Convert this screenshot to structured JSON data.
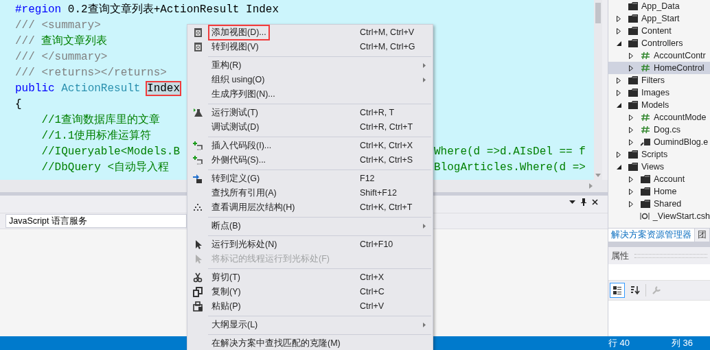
{
  "editor": {
    "lines": [
      {
        "segments": [
          {
            "text": "#region",
            "kind": "keyword"
          },
          {
            "text": " 0.2查询文章列表+ActionResult Index",
            "kind": "plain"
          }
        ]
      },
      {
        "segments": [
          {
            "text": "/// <summary>",
            "kind": "doc"
          }
        ]
      },
      {
        "segments": [
          {
            "text": "/// ",
            "kind": "doc"
          },
          {
            "text": "查询文章列表",
            "kind": "comment"
          }
        ]
      },
      {
        "segments": [
          {
            "text": "/// </summary>",
            "kind": "doc"
          }
        ]
      },
      {
        "segments": [
          {
            "text": "/// <returns></returns>",
            "kind": "doc"
          }
        ]
      },
      {
        "segments": [
          {
            "text": "public ",
            "kind": "keyword"
          },
          {
            "text": "ActionResult ",
            "kind": "type"
          },
          {
            "text": "Index",
            "kind": "plain",
            "marked": true
          }
        ]
      },
      {
        "segments": [
          {
            "text": "{",
            "kind": "plain"
          }
        ]
      },
      {
        "segments": [
          {
            "text": "    //1查询数据库里的文章",
            "kind": "comment"
          }
        ]
      },
      {
        "segments": [
          {
            "text": "    //1.1使用标准运算符",
            "kind": "comment"
          }
        ]
      },
      {
        "segments": [
          {
            "text": "    //IQueryable<Models.B",
            "kind": "comment"
          }
        ],
        "tail": {
          "text": "Where(d =>d.AIsDel == f",
          "kind": "comment"
        }
      },
      {
        "segments": [
          {
            "text": "    //DbQuery <自动导入程",
            "kind": "comment"
          }
        ],
        "tail": {
          "text": "BlogArticles.Where(d =>",
          "kind": "comment"
        }
      }
    ]
  },
  "context_menu": {
    "items": [
      {
        "kind": "item",
        "label": "添加视图(D)...",
        "shortcut": "Ctrl+M, Ctrl+V",
        "marked": true,
        "disabled": false,
        "submenu": false
      },
      {
        "kind": "item",
        "label": "转到视图(V)",
        "shortcut": "Ctrl+M, Ctrl+G",
        "marked": false,
        "disabled": false,
        "submenu": false
      },
      {
        "kind": "separator"
      },
      {
        "kind": "item",
        "label": "重构(R)",
        "marked": false,
        "disabled": false,
        "submenu": true
      },
      {
        "kind": "item",
        "label": "组织 using(O)",
        "marked": false,
        "disabled": false,
        "submenu": true
      },
      {
        "kind": "item",
        "label": "生成序列图(N)...",
        "marked": false,
        "disabled": false,
        "submenu": false
      },
      {
        "kind": "separator"
      },
      {
        "kind": "item",
        "label": "运行测试(T)",
        "shortcut": "Ctrl+R, T",
        "marked": false,
        "disabled": false,
        "submenu": false
      },
      {
        "kind": "item",
        "label": "调试测试(D)",
        "shortcut": "Ctrl+R, Ctrl+T",
        "marked": false,
        "disabled": false,
        "submenu": false
      },
      {
        "kind": "separator"
      },
      {
        "kind": "item",
        "label": "插入代码段(I)...",
        "shortcut": "Ctrl+K, Ctrl+X",
        "marked": false,
        "disabled": false,
        "submenu": false
      },
      {
        "kind": "item",
        "label": "外侧代码(S)...",
        "shortcut": "Ctrl+K, Ctrl+S",
        "marked": false,
        "disabled": false,
        "submenu": false
      },
      {
        "kind": "separator"
      },
      {
        "kind": "item",
        "label": "转到定义(G)",
        "shortcut": "F12",
        "marked": false,
        "disabled": false,
        "submenu": false
      },
      {
        "kind": "item",
        "label": "查找所有引用(A)",
        "shortcut": "Shift+F12",
        "marked": false,
        "disabled": false,
        "submenu": false
      },
      {
        "kind": "item",
        "label": "查看调用层次结构(H)",
        "shortcut": "Ctrl+K, Ctrl+T",
        "marked": false,
        "disabled": false,
        "submenu": false
      },
      {
        "kind": "separator"
      },
      {
        "kind": "item",
        "label": "断点(B)",
        "marked": false,
        "disabled": false,
        "submenu": true
      },
      {
        "kind": "separator"
      },
      {
        "kind": "item",
        "label": "运行到光标处(N)",
        "shortcut": "Ctrl+F10",
        "marked": false,
        "disabled": false,
        "submenu": false
      },
      {
        "kind": "item",
        "label": "将标记的线程运行到光标处(F)",
        "marked": false,
        "disabled": true,
        "submenu": false
      },
      {
        "kind": "separator"
      },
      {
        "kind": "item",
        "label": "剪切(T)",
        "shortcut": "Ctrl+X",
        "marked": false,
        "disabled": false,
        "submenu": false
      },
      {
        "kind": "item",
        "label": "复制(Y)",
        "shortcut": "Ctrl+C",
        "marked": false,
        "disabled": false,
        "submenu": false
      },
      {
        "kind": "item",
        "label": "粘贴(P)",
        "shortcut": "Ctrl+V",
        "marked": false,
        "disabled": false,
        "submenu": false
      },
      {
        "kind": "separator"
      },
      {
        "kind": "item",
        "label": "大纲显示(L)",
        "marked": false,
        "disabled": false,
        "submenu": true
      },
      {
        "kind": "separator"
      },
      {
        "kind": "item",
        "label": "在解决方案中查找匹配的克隆(M)",
        "marked": false,
        "disabled": false,
        "submenu": false
      }
    ]
  },
  "bottom_panel": {
    "dropdown": {
      "value": "JavaScript 语言服务"
    }
  },
  "solution_explorer": {
    "items": [
      {
        "label": "App_Data",
        "kind": "folder"
      },
      {
        "label": "App_Start",
        "kind": "folder",
        "expanded": false
      },
      {
        "label": "Content",
        "kind": "folder",
        "expanded": false
      },
      {
        "label": "Controllers",
        "kind": "folder",
        "expanded": true,
        "children": [
          {
            "label": "AccountContr",
            "kind": "code",
            "expanded": false,
            "selected": false
          },
          {
            "label": "HomeControl",
            "kind": "code",
            "expanded": false,
            "selected": true
          }
        ]
      },
      {
        "label": "Filters",
        "kind": "folder",
        "expanded": false
      },
      {
        "label": "Images",
        "kind": "folder",
        "expanded": false
      },
      {
        "label": "Models",
        "kind": "folder",
        "expanded": true,
        "children": [
          {
            "label": "AccountMode",
            "kind": "code",
            "expanded": false,
            "selected": false
          },
          {
            "label": "Dog.cs",
            "kind": "code",
            "expanded": false,
            "selected": false
          },
          {
            "label": "OumindBlog.e",
            "kind": "model",
            "expanded": false,
            "selected": false
          }
        ]
      },
      {
        "label": "Scripts",
        "kind": "folder",
        "expanded": false
      },
      {
        "label": "Views",
        "kind": "folder",
        "expanded": true,
        "children": [
          {
            "label": "Account",
            "kind": "folder",
            "expanded": false,
            "selected": false
          },
          {
            "label": "Home",
            "kind": "folder",
            "expanded": false,
            "selected": false
          },
          {
            "label": "Shared",
            "kind": "folder",
            "expanded": false,
            "selected": false
          },
          {
            "label": "_ViewStart.csh",
            "kind": "view",
            "selected": false
          }
        ]
      }
    ],
    "tabs": [
      {
        "label": "解决方案资源管理器",
        "selected": true
      },
      {
        "label": "团",
        "selected": false
      }
    ]
  },
  "properties": {
    "title": "属性",
    "toolbar": [
      {
        "selected": true,
        "disabled": false
      },
      {
        "selected": false,
        "disabled": false
      },
      {
        "selected": false,
        "disabled": true
      }
    ]
  },
  "status_bar": {
    "line": "行 40",
    "column": "列 36"
  }
}
